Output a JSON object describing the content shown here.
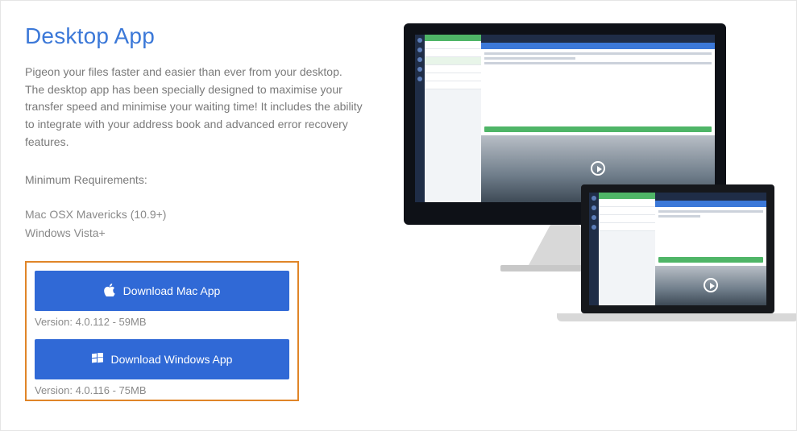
{
  "title": "Desktop App",
  "description": "Pigeon your files faster and easier than ever from your desktop. The desktop app has been specially designed to maximise your transfer speed and minimise your waiting time! It includes the ability to integrate with your address book and advanced error recovery features.",
  "requirements_heading": "Minimum Requirements:",
  "requirements": {
    "mac": "Mac OSX Mavericks (10.9+)",
    "windows": "Windows Vista+"
  },
  "downloads": {
    "mac": {
      "label": "Download Mac App",
      "version_line": "Version: 4.0.112 - 59MB"
    },
    "windows": {
      "label": "Download Windows App",
      "version_line": "Version: 4.0.116 - 75MB"
    }
  }
}
